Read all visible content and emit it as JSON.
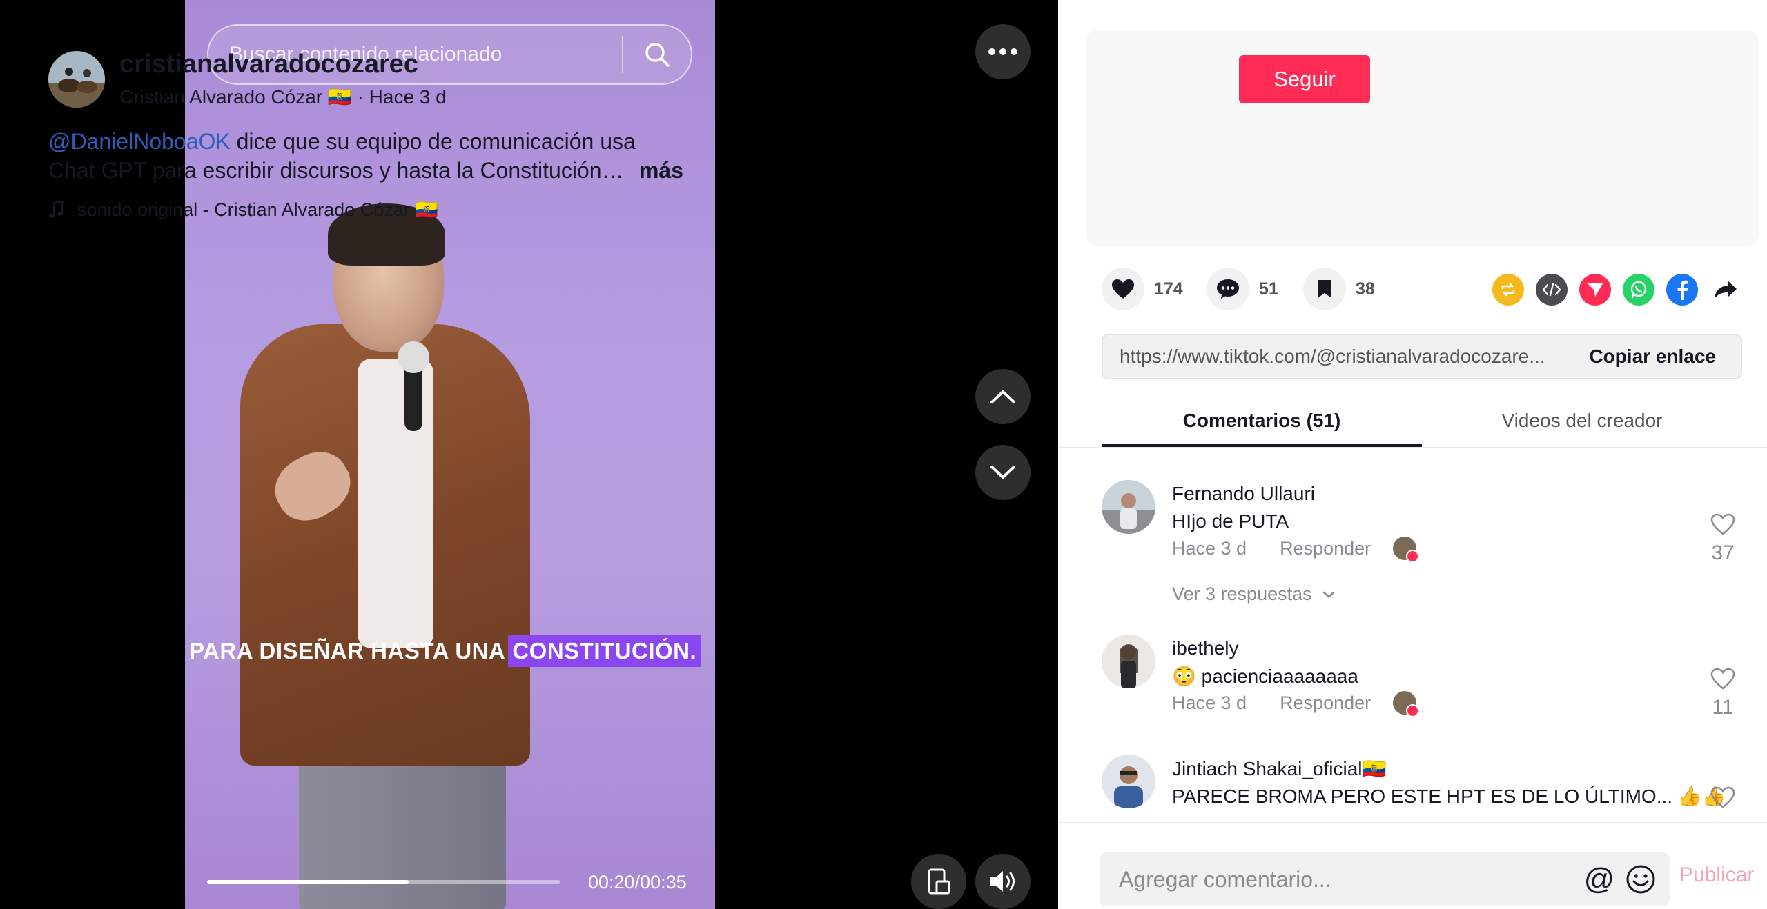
{
  "video": {
    "search_placeholder": "Buscar contenido relacionado",
    "caption_plain": "PARA DISEÑAR HASTA UNA",
    "caption_highlight": "CONSTITUCIÓN.",
    "time": "00:20/00:35",
    "progress_fraction": 0.571,
    "controls": [
      "more-icon",
      "chevron-up-icon",
      "chevron-down-icon",
      "pip-icon",
      "volume-icon"
    ]
  },
  "post": {
    "username": "cristianalvaradocozarec",
    "display_name": "Cristian Alvarado Cózar",
    "flag": "🇪🇨",
    "time_ago": "· Hace 3 d",
    "follow_label": "Seguir",
    "mention": "@DanielNoboaOK",
    "description_line1": " dice que su equipo de comunicación usa",
    "description_line2": "Chat GPT para escribir discursos y hasta la Constitución…",
    "more_label": "más",
    "sound": "sonido original - Cristian Alvarado Cózar 🇪🇨"
  },
  "stats": {
    "likes": "174",
    "comments": "51",
    "saves": "38"
  },
  "share": {
    "icons": [
      "repost-icon",
      "embed-icon",
      "send-icon",
      "whatsapp-icon",
      "facebook-icon",
      "share-arrow-icon"
    ],
    "colors": {
      "repost": "#f4b91d",
      "embed": "#4b4b50",
      "send": "#fe2c55",
      "whatsapp": "#25d366",
      "facebook": "#1877f2"
    }
  },
  "link": {
    "url": "https://www.tiktok.com/@cristianalvaradocozare...",
    "copy_label": "Copiar enlace"
  },
  "tabs": {
    "comments": "Comentarios (51)",
    "creator": "Videos del creador"
  },
  "comments": [
    {
      "name": "Fernando Ullauri",
      "text": "HIjo de PUTA",
      "time": "Hace 3 d",
      "reply": "Responder",
      "likes": "37",
      "replies": "Ver 3 respuestas"
    },
    {
      "name": "ibethely",
      "text": "😳 pacienciaaaaaaaa",
      "time": "Hace 3 d",
      "reply": "Responder",
      "likes": "11"
    },
    {
      "name": "Jintiach Shakai_oficial🇪🇨",
      "text": "PARECE BROMA PERO ESTE HPT ES DE LO ÚLTIMO... 👍👍"
    }
  ],
  "composer": {
    "placeholder": "Agregar comentario...",
    "mention_symbol": "@",
    "publish_label": "Publicar"
  },
  "colors": {
    "accent": "#fe2c55",
    "mention": "#2b5db9",
    "video_bg": "#b59be0",
    "caption_highlight": "#8b46f0"
  }
}
